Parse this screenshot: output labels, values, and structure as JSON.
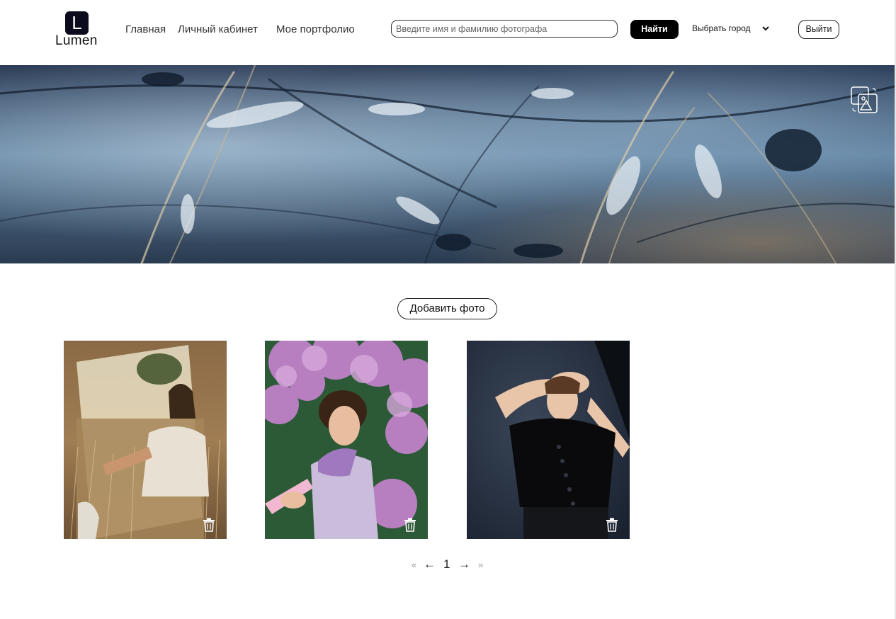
{
  "logo": {
    "letter": "L",
    "name": "Lumen"
  },
  "nav": {
    "items": [
      {
        "label": "Главная"
      },
      {
        "label": "Личный кабинет"
      },
      {
        "label": "Мое портфолио"
      }
    ]
  },
  "search": {
    "placeholder": "Введите имя и фамилию фотографа",
    "value": "",
    "button_label": "Найти"
  },
  "city_select": {
    "label": "Выбрать город"
  },
  "logout_label": "Выйти",
  "banner": {
    "edit_icon": "change-cover-icon"
  },
  "add_photo_label": "Добавить фото",
  "gallery": {
    "photos": [
      {
        "subject": "woman-with-mirror-in-field",
        "delete_icon": "trash-icon"
      },
      {
        "subject": "woman-in-lilac-flowers",
        "delete_icon": "trash-icon"
      },
      {
        "subject": "woman-in-black-studio",
        "delete_icon": "trash-icon"
      }
    ]
  },
  "pagination": {
    "first": "«",
    "prev": "←",
    "current": "1",
    "next": "→",
    "last": "»"
  },
  "colors": {
    "accent": "#000000",
    "logo_bg": "#0c0b1e",
    "banner_base": "#3c5a78"
  }
}
